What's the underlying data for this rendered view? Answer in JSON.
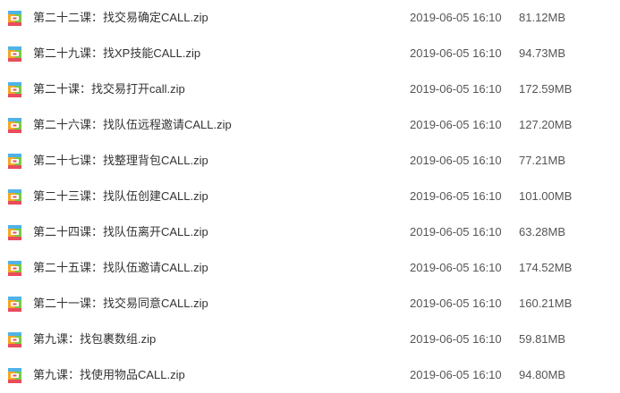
{
  "file_list": {
    "icon": "archive-file-icon",
    "items": [
      {
        "name": "第二十二课：找交易确定CALL.zip",
        "date": "2019-06-05 16:10",
        "size": "81.12MB"
      },
      {
        "name": "第二十九课：找XP技能CALL.zip",
        "date": "2019-06-05 16:10",
        "size": "94.73MB"
      },
      {
        "name": "第二十课：找交易打开call.zip",
        "date": "2019-06-05 16:10",
        "size": "172.59MB"
      },
      {
        "name": "第二十六课：找队伍远程邀请CALL.zip",
        "date": "2019-06-05 16:10",
        "size": "127.20MB"
      },
      {
        "name": "第二十七课：找整理背包CALL.zip",
        "date": "2019-06-05 16:10",
        "size": "77.21MB"
      },
      {
        "name": "第二十三课：找队伍创建CALL.zip",
        "date": "2019-06-05 16:10",
        "size": "101.00MB"
      },
      {
        "name": "第二十四课：找队伍离开CALL.zip",
        "date": "2019-06-05 16:10",
        "size": "63.28MB"
      },
      {
        "name": "第二十五课：找队伍邀请CALL.zip",
        "date": "2019-06-05 16:10",
        "size": "174.52MB"
      },
      {
        "name": "第二十一课：找交易同意CALL.zip",
        "date": "2019-06-05 16:10",
        "size": "160.21MB"
      },
      {
        "name": "第九课：找包裹数组.zip",
        "date": "2019-06-05 16:10",
        "size": "59.81MB"
      },
      {
        "name": "第九课：找使用物品CALL.zip",
        "date": "2019-06-05 16:10",
        "size": "94.80MB"
      }
    ]
  },
  "colors": {
    "icon_top": "#4fb3e8",
    "icon_left": "#f5a623",
    "icon_right": "#7ac943",
    "icon_bottom": "#e84c5d",
    "icon_center": "#ffffff",
    "text": "#333333",
    "meta_text": "#555555"
  }
}
